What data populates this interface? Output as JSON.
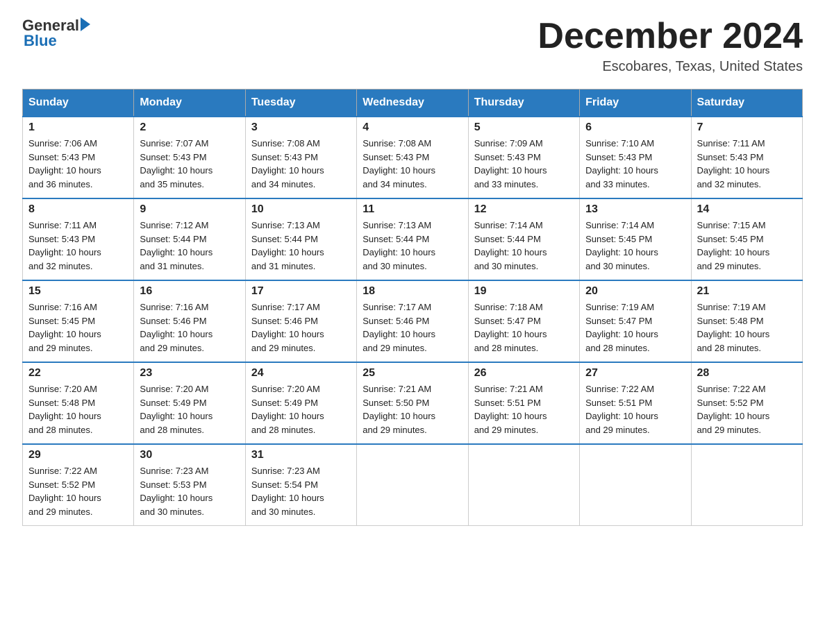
{
  "logo": {
    "general": "General",
    "blue": "Blue"
  },
  "title": {
    "month_year": "December 2024",
    "location": "Escobares, Texas, United States"
  },
  "weekdays": [
    "Sunday",
    "Monday",
    "Tuesday",
    "Wednesday",
    "Thursday",
    "Friday",
    "Saturday"
  ],
  "weeks": [
    [
      {
        "day": "1",
        "sunrise": "7:06 AM",
        "sunset": "5:43 PM",
        "daylight": "10 hours and 36 minutes."
      },
      {
        "day": "2",
        "sunrise": "7:07 AM",
        "sunset": "5:43 PM",
        "daylight": "10 hours and 35 minutes."
      },
      {
        "day": "3",
        "sunrise": "7:08 AM",
        "sunset": "5:43 PM",
        "daylight": "10 hours and 34 minutes."
      },
      {
        "day": "4",
        "sunrise": "7:08 AM",
        "sunset": "5:43 PM",
        "daylight": "10 hours and 34 minutes."
      },
      {
        "day": "5",
        "sunrise": "7:09 AM",
        "sunset": "5:43 PM",
        "daylight": "10 hours and 33 minutes."
      },
      {
        "day": "6",
        "sunrise": "7:10 AM",
        "sunset": "5:43 PM",
        "daylight": "10 hours and 33 minutes."
      },
      {
        "day": "7",
        "sunrise": "7:11 AM",
        "sunset": "5:43 PM",
        "daylight": "10 hours and 32 minutes."
      }
    ],
    [
      {
        "day": "8",
        "sunrise": "7:11 AM",
        "sunset": "5:43 PM",
        "daylight": "10 hours and 32 minutes."
      },
      {
        "day": "9",
        "sunrise": "7:12 AM",
        "sunset": "5:44 PM",
        "daylight": "10 hours and 31 minutes."
      },
      {
        "day": "10",
        "sunrise": "7:13 AM",
        "sunset": "5:44 PM",
        "daylight": "10 hours and 31 minutes."
      },
      {
        "day": "11",
        "sunrise": "7:13 AM",
        "sunset": "5:44 PM",
        "daylight": "10 hours and 30 minutes."
      },
      {
        "day": "12",
        "sunrise": "7:14 AM",
        "sunset": "5:44 PM",
        "daylight": "10 hours and 30 minutes."
      },
      {
        "day": "13",
        "sunrise": "7:14 AM",
        "sunset": "5:45 PM",
        "daylight": "10 hours and 30 minutes."
      },
      {
        "day": "14",
        "sunrise": "7:15 AM",
        "sunset": "5:45 PM",
        "daylight": "10 hours and 29 minutes."
      }
    ],
    [
      {
        "day": "15",
        "sunrise": "7:16 AM",
        "sunset": "5:45 PM",
        "daylight": "10 hours and 29 minutes."
      },
      {
        "day": "16",
        "sunrise": "7:16 AM",
        "sunset": "5:46 PM",
        "daylight": "10 hours and 29 minutes."
      },
      {
        "day": "17",
        "sunrise": "7:17 AM",
        "sunset": "5:46 PM",
        "daylight": "10 hours and 29 minutes."
      },
      {
        "day": "18",
        "sunrise": "7:17 AM",
        "sunset": "5:46 PM",
        "daylight": "10 hours and 29 minutes."
      },
      {
        "day": "19",
        "sunrise": "7:18 AM",
        "sunset": "5:47 PM",
        "daylight": "10 hours and 28 minutes."
      },
      {
        "day": "20",
        "sunrise": "7:19 AM",
        "sunset": "5:47 PM",
        "daylight": "10 hours and 28 minutes."
      },
      {
        "day": "21",
        "sunrise": "7:19 AM",
        "sunset": "5:48 PM",
        "daylight": "10 hours and 28 minutes."
      }
    ],
    [
      {
        "day": "22",
        "sunrise": "7:20 AM",
        "sunset": "5:48 PM",
        "daylight": "10 hours and 28 minutes."
      },
      {
        "day": "23",
        "sunrise": "7:20 AM",
        "sunset": "5:49 PM",
        "daylight": "10 hours and 28 minutes."
      },
      {
        "day": "24",
        "sunrise": "7:20 AM",
        "sunset": "5:49 PM",
        "daylight": "10 hours and 28 minutes."
      },
      {
        "day": "25",
        "sunrise": "7:21 AM",
        "sunset": "5:50 PM",
        "daylight": "10 hours and 29 minutes."
      },
      {
        "day": "26",
        "sunrise": "7:21 AM",
        "sunset": "5:51 PM",
        "daylight": "10 hours and 29 minutes."
      },
      {
        "day": "27",
        "sunrise": "7:22 AM",
        "sunset": "5:51 PM",
        "daylight": "10 hours and 29 minutes."
      },
      {
        "day": "28",
        "sunrise": "7:22 AM",
        "sunset": "5:52 PM",
        "daylight": "10 hours and 29 minutes."
      }
    ],
    [
      {
        "day": "29",
        "sunrise": "7:22 AM",
        "sunset": "5:52 PM",
        "daylight": "10 hours and 29 minutes."
      },
      {
        "day": "30",
        "sunrise": "7:23 AM",
        "sunset": "5:53 PM",
        "daylight": "10 hours and 30 minutes."
      },
      {
        "day": "31",
        "sunrise": "7:23 AM",
        "sunset": "5:54 PM",
        "daylight": "10 hours and 30 minutes."
      },
      null,
      null,
      null,
      null
    ]
  ],
  "labels": {
    "sunrise": "Sunrise:",
    "sunset": "Sunset:",
    "daylight": "Daylight:"
  }
}
